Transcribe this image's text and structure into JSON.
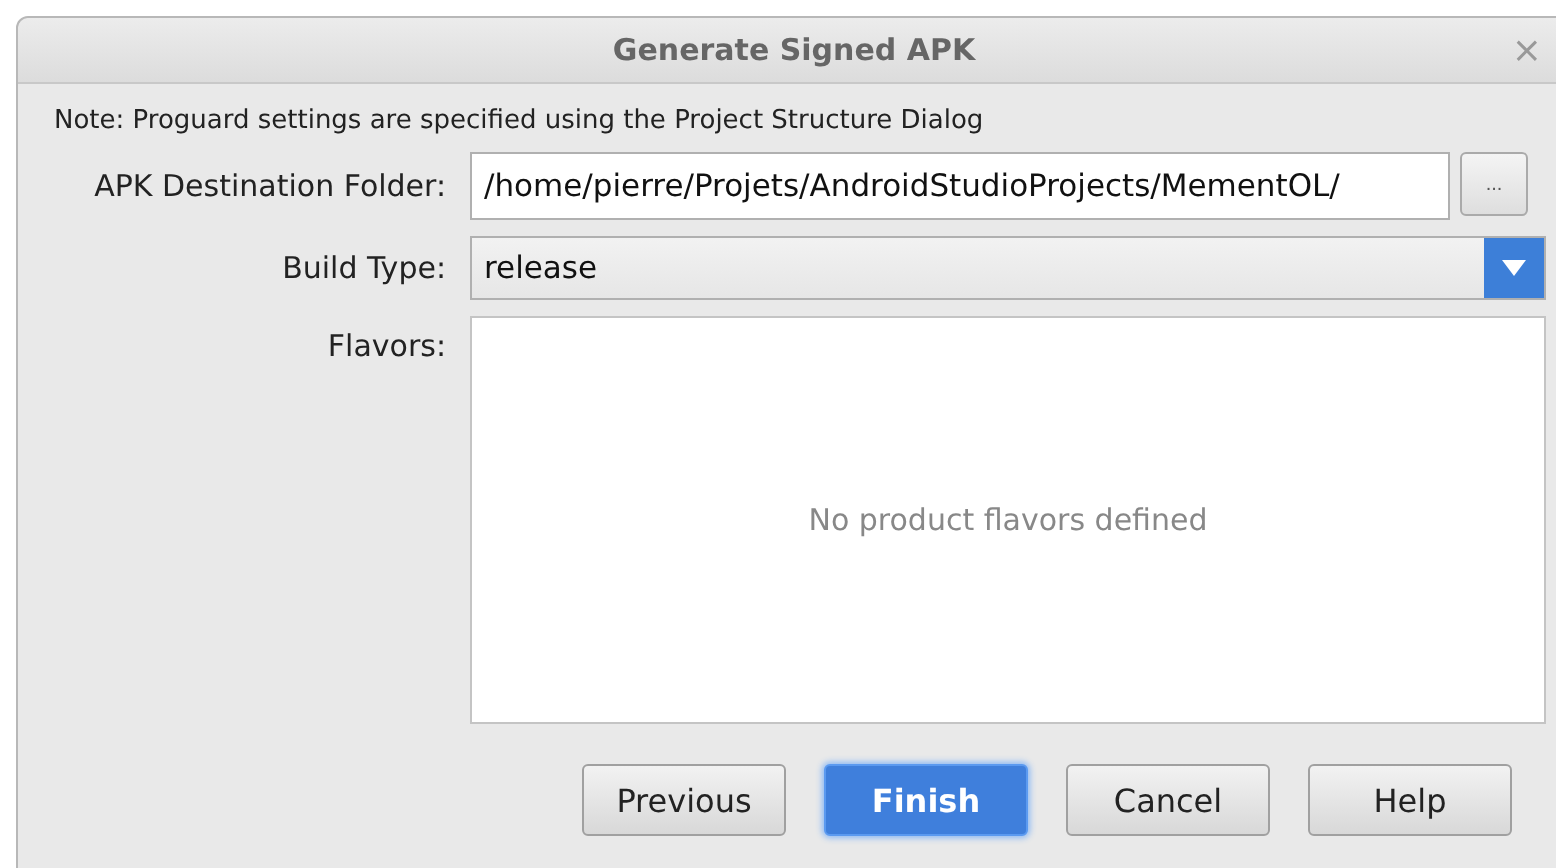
{
  "window": {
    "title": "Generate Signed APK",
    "close": "×"
  },
  "note": "Note: Proguard settings are specified using the Project Structure Dialog",
  "destination": {
    "label": "APK Destination Folder:",
    "value": "/home/pierre/Projets/AndroidStudioProjects/MementOL/",
    "browse": "..."
  },
  "build_type": {
    "label": "Build Type:",
    "value": "release"
  },
  "flavors": {
    "label": "Flavors:",
    "empty_text": "No product flavors defined"
  },
  "buttons": [
    {
      "label": "Previous",
      "default": false
    },
    {
      "label": "Finish",
      "default": true
    },
    {
      "label": "Cancel",
      "default": false
    },
    {
      "label": "Help",
      "default": false
    }
  ]
}
